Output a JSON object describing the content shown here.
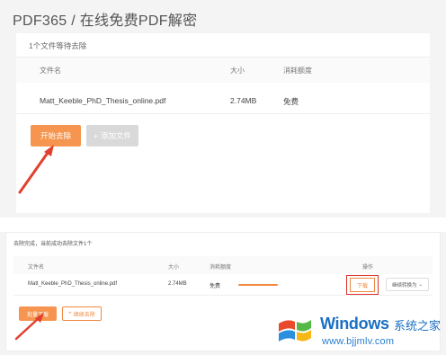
{
  "header": {
    "title": "PDF365 / 在线免费PDF解密"
  },
  "queue": {
    "status": "1个文件等待去除",
    "columns": {
      "file_name": "文件名",
      "size": "大小",
      "cost": "消耗额度"
    },
    "row": {
      "file_name": "Matt_Keeble_PhD_Thesis_online.pdf",
      "size": "2.74MB",
      "cost": "免费"
    },
    "start_button": "开始去除",
    "add_button": "添加文件",
    "add_icon": "plus-icon"
  },
  "result": {
    "status": "去除完成，当前成功去除文件1个",
    "columns": {
      "file_name": "文件名",
      "size": "大小",
      "cost": "消耗额度",
      "action": "操作"
    },
    "row": {
      "file_name": "Matt_Keeble_PhD_Thesis_online.pdf",
      "size": "2.74MB",
      "cost": "免费",
      "download": "下载",
      "continue_select": "继续转换为",
      "progress": 1.0
    },
    "batch_download": "批量下载",
    "continue_button": "继续去除"
  },
  "annotation": {
    "arrow_color": "#e2402f",
    "highlight_color": "#d9342b"
  },
  "watermark": {
    "brand": "Windows",
    "cn": "系统之家",
    "url": "www.bjjmlv.com"
  },
  "colors": {
    "accent": "#f5954f",
    "disabled": "#d9d9d9",
    "watermark_blue": "#1a6fc4"
  }
}
